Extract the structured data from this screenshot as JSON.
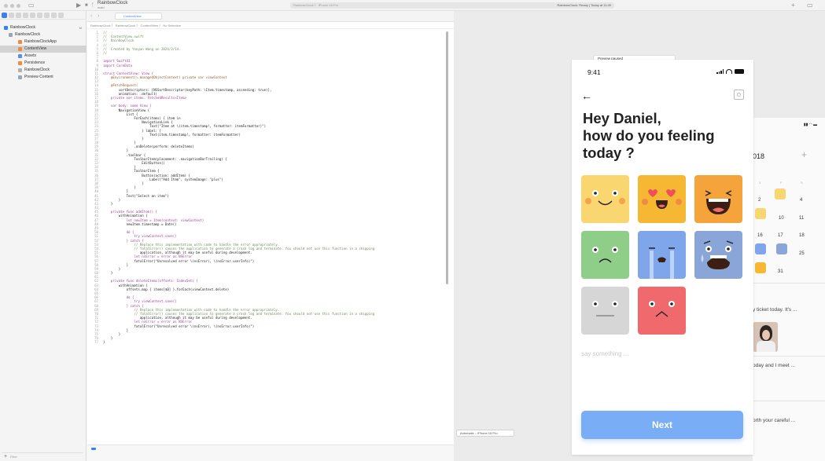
{
  "titlebar": {
    "project": "RainbowClock",
    "branch": "main",
    "run_destination": "RainbowClock 〉 iPhone 15 Pro",
    "status": "RainbowClock: Ready | Today at 11:40"
  },
  "navigator": {
    "items": [
      {
        "label": "RainbowClock",
        "badge": "M"
      },
      {
        "label": "RainbowClock",
        "badge": ""
      },
      {
        "label": "RainbowClockApp",
        "badge": ""
      },
      {
        "label": "ContentView",
        "badge": ""
      },
      {
        "label": "Assets",
        "badge": ""
      },
      {
        "label": "Persistence",
        "badge": ""
      },
      {
        "label": "RainbowClock",
        "badge": ""
      },
      {
        "label": "Preview Content",
        "badge": ""
      }
    ],
    "filter_placeholder": "Filter"
  },
  "editor": {
    "tab": "ContentView",
    "jumpbar": "RainbowClock 〉 RainbowClock 〉 ContentView 〉 No Selection",
    "lines": [
      "//",
      "//  ContentView.swift",
      "//  RainbowClock",
      "//",
      "//  Created by Yanyan Wang on 2024/3/14.",
      "//",
      "",
      "import SwiftUI",
      "import CoreData",
      "",
      "struct ContentView: View {",
      "    @Environment(\\.managedObjectContext) private var viewContext",
      "",
      "    @FetchRequest(",
      "        sortDescriptors: [NSSortDescriptor(keyPath: \\Item.timestamp, ascending: true)],",
      "        animation: .default)",
      "    private var items: FetchedResults<Item>",
      "",
      "    var body: some View {",
      "        NavigationView {",
      "            List {",
      "                ForEach(items) { item in",
      "                    NavigationLink {",
      "                        Text(\"Item at \\(item.timestamp!, formatter: itemFormatter)\")",
      "                    } label: {",
      "                        Text(item.timestamp!, formatter: itemFormatter)",
      "                    }",
      "                }",
      "                .onDelete(perform: deleteItems)",
      "            }",
      "            .toolbar {",
      "                ToolbarItem(placement: .navigationBarTrailing) {",
      "                    EditButton()",
      "                }",
      "                ToolbarItem {",
      "                    Button(action: addItem) {",
      "                        Label(\"Add Item\", systemImage: \"plus\")",
      "                    }",
      "                }",
      "            }",
      "            Text(\"Select an item\")",
      "        }",
      "    }",
      "",
      "    private func addItem() {",
      "        withAnimation {",
      "            let newItem = Item(context: viewContext)",
      "            newItem.timestamp = Date()",
      "",
      "            do {",
      "                try viewContext.save()",
      "            } catch {",
      "                // Replace this implementation with code to handle the error appropriately.",
      "                // fatalError() causes the application to generate a crash log and terminate. You should not use this function in a shipping",
      "                   application, although it may be useful during development.",
      "                let nsError = error as NSError",
      "                fatalError(\"Unresolved error \\(nsError), \\(nsError.userInfo)\")",
      "            }",
      "        }",
      "    }",
      "",
      "    private func deleteItems(offsets: IndexSet) {",
      "        withAnimation {",
      "            offsets.map { items[$0] }.forEach(viewContext.delete)",
      "",
      "            do {",
      "                try viewContext.save()",
      "            } catch {",
      "                // Replace this implementation with code to handle the error appropriately.",
      "                // fatalError() causes the application to generate a crash log and terminate. You should not use this function in a shipping",
      "                   application, although it may be useful during development.",
      "                let nsError = error as NSError",
      "                fatalError(\"Unresolved error \\(nsError), \\(nsError.userInfo)\")",
      "            }",
      "        }",
      "    }",
      "}"
    ]
  },
  "canvas": {
    "pill": "Preview paused",
    "device": "Automatic – iPhone 15 Pro"
  },
  "preview": {
    "time": "9:41",
    "heading_line1": "Hey Daniel,",
    "heading_line2": "how do you feeling",
    "heading_line3": "today ?",
    "input_placeholder": "say something ...",
    "next_button": "Next",
    "moods": [
      {
        "name": "happy",
        "color": "#f9d66f"
      },
      {
        "name": "in-love",
        "color": "#f6b733"
      },
      {
        "name": "laughing",
        "color": "#f5a43c"
      },
      {
        "name": "sad",
        "color": "#8fce89"
      },
      {
        "name": "crying",
        "color": "#7fa6ea"
      },
      {
        "name": "shocked",
        "color": "#8aa5d7"
      },
      {
        "name": "neutral",
        "color": "#d6d6d6"
      },
      {
        "name": "angry",
        "color": "#f06a6d"
      }
    ]
  },
  "background_preview": {
    "year": "018",
    "weekdays": [
      "1",
      "F",
      "S"
    ],
    "days": [
      "2",
      "4",
      "10",
      "11",
      "16",
      "17",
      "18",
      "25",
      "31"
    ],
    "snippet1": "y ticket today. It's ...",
    "snippet2": "oday and I meet ...",
    "snippet3": "orth your careful ..."
  }
}
